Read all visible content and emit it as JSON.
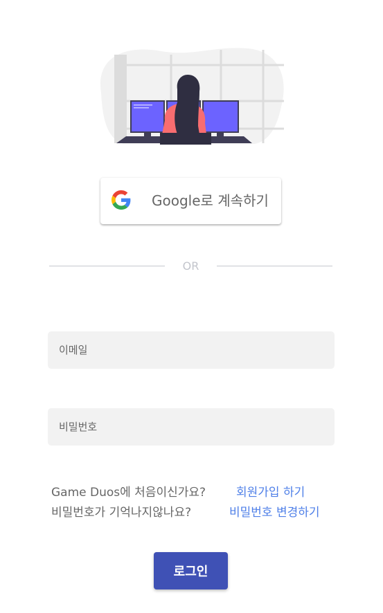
{
  "illustration": {
    "icon": "person-at-computers-illustration"
  },
  "google": {
    "label": "Google로 계속하기",
    "icon": "google-g-icon"
  },
  "divider": {
    "text": "OR"
  },
  "form": {
    "email_placeholder": "이메일",
    "password_placeholder": "비밀번호"
  },
  "help": {
    "signup_prompt": "Game Duos에 처음이신가요?",
    "signup_link": "회원가입 하기",
    "forgot_prompt": "비밀번호가 기억나지않나요?",
    "forgot_link": "비밀번호 변경하기"
  },
  "login": {
    "label": "로그인"
  },
  "colors": {
    "primary": "#3f51b5",
    "link": "#4e7fe8",
    "field_bg": "#f2f2f2",
    "illustration_accent": "#6c63ff"
  }
}
